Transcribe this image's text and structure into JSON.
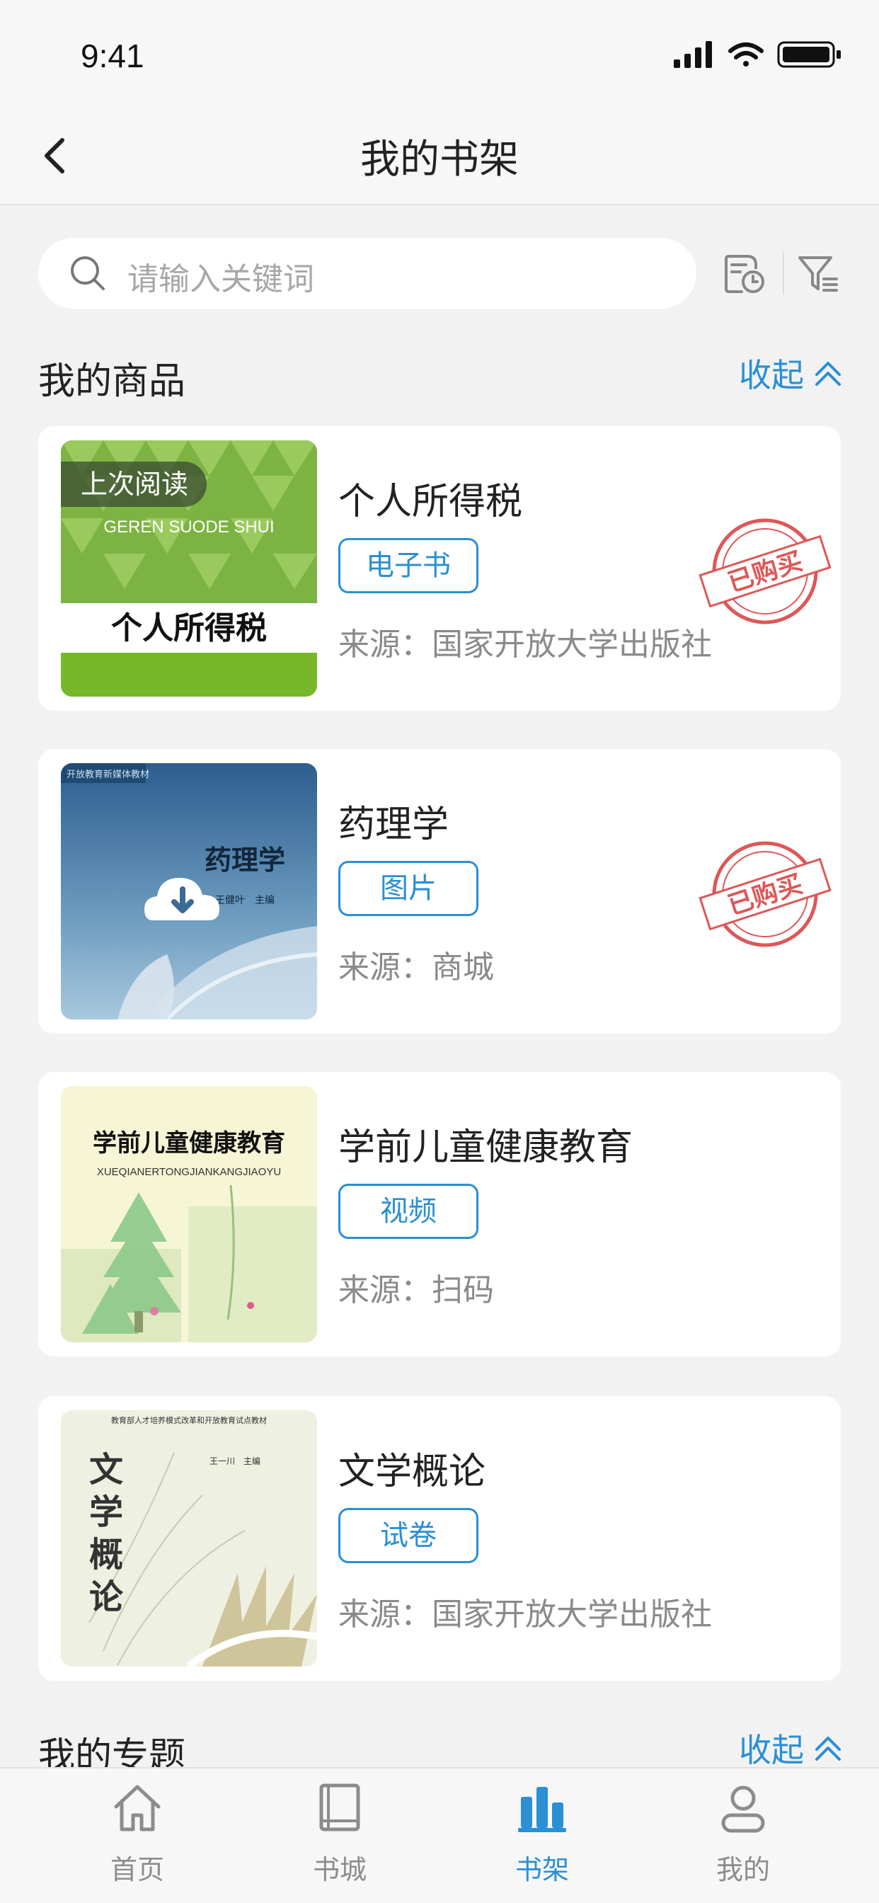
{
  "status": {
    "time": "9:41"
  },
  "nav": {
    "title": "我的书架"
  },
  "search": {
    "placeholder": "请输入关键词"
  },
  "sections": {
    "products": {
      "title": "我的商品",
      "collapse": "收起"
    },
    "topics": {
      "title": "我的专题",
      "collapse": "收起"
    }
  },
  "books": [
    {
      "title": "个人所得税",
      "type": "电子书",
      "source": "来源：国家开放大学出版社",
      "purchased": true,
      "badge": "上次阅读",
      "cover": {
        "main": "个人所得税",
        "sub": "GEREN SUODE SHUI"
      },
      "stamp": "已购买"
    },
    {
      "title": "药理学",
      "type": "图片",
      "source": "来源：商城",
      "purchased": true,
      "cover": {
        "main": "药理学",
        "top": "开放教育新媒体教材",
        "author": "王健叶　主编"
      },
      "stamp": "已购买"
    },
    {
      "title": "学前儿童健康教育",
      "type": "视频",
      "source": "来源：扫码",
      "purchased": false,
      "cover": {
        "main": "学前儿童健康教育",
        "sub": "XUEQIANERTONGJIANKANGJIAOYU"
      }
    },
    {
      "title": "文学概论",
      "type": "试卷",
      "source": "来源：国家开放大学出版社",
      "purchased": false,
      "cover": {
        "main": "文学概论",
        "top": "教育部人才培养模式改革和开放教育试点教材",
        "author": "王一川　主编"
      }
    }
  ],
  "tabs": [
    {
      "label": "首页",
      "icon": "home-icon",
      "active": false
    },
    {
      "label": "书城",
      "icon": "book-icon",
      "active": false
    },
    {
      "label": "书架",
      "icon": "bookshelf-icon",
      "active": true
    },
    {
      "label": "我的",
      "icon": "profile-icon",
      "active": false
    }
  ],
  "colors": {
    "accent": "#2a8fd5",
    "stamp": "#d93a3a",
    "background": "#f2f2f2"
  }
}
